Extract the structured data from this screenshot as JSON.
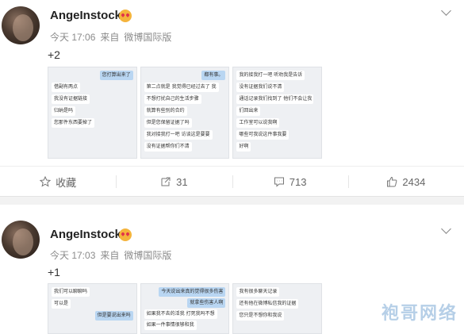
{
  "posts": [
    {
      "username": "AngeInstock",
      "time": "今天 17:06",
      "source_prefix": "来自",
      "source": "微博国际版",
      "content": "+2",
      "images": [
        {
          "bubbles": [
            {
              "t": "您打算出来了",
              "me": true
            },
            {
              "t": "借副有两点",
              "me": false
            },
            {
              "t": "我没有证据链接",
              "me": false
            },
            {
              "t": "归纳是吗",
              "me": false
            },
            {
              "t": "您那件东西要掉了",
              "me": false
            }
          ]
        },
        {
          "bubbles": [
            {
              "t": "都有事。",
              "me": true
            },
            {
              "t": "第二点就是 我觉得已经过去了 我",
              "me": false
            },
            {
              "t": "不想打扰自己的生活步骤",
              "me": false
            },
            {
              "t": "就算有些别的合约",
              "me": false
            },
            {
              "t": "但是您保留证据了吗",
              "me": false
            },
            {
              "t": "我对接我打一吧 访谈这是要要",
              "me": false
            },
            {
              "t": "没有证据帮你们不清",
              "me": false
            }
          ]
        },
        {
          "bubbles": [
            {
              "t": "我的接我打一吧 听劝我是告诉",
              "me": false
            },
            {
              "t": "没有证据我们说不清",
              "me": false
            },
            {
              "t": "通话记录我们找到了 他们不会让我",
              "me": false
            },
            {
              "t": "们回出来",
              "me": false
            },
            {
              "t": "工作室可以说我啊",
              "me": false
            },
            {
              "t": "哪些可我说这件事我要",
              "me": false
            },
            {
              "t": "好啊",
              "me": false
            }
          ]
        }
      ],
      "actions": {
        "favorite": "收藏",
        "repost": "31",
        "comment": "713",
        "like": "2434"
      }
    },
    {
      "username": "AngeInstock",
      "time": "今天 17:03",
      "source_prefix": "来自",
      "source": "微博国际版",
      "content": "+1",
      "images": [
        {
          "bubbles": [
            {
              "t": "我们可以聊聊吗",
              "me": false
            },
            {
              "t": "可以是",
              "me": false
            },
            {
              "t": "但是要说出来吗",
              "me": true
            }
          ]
        },
        {
          "bubbles": [
            {
              "t": "今天说出来真的觉得很多伤害",
              "me": true
            },
            {
              "t": "就拿些伤害人啊",
              "me": true
            },
            {
              "t": "如果我不去的活我 打死我吗不想",
              "me": false
            },
            {
              "t": "如果一件事情很够和我",
              "me": false
            }
          ]
        },
        {
          "bubbles": [
            {
              "t": "我有很多聊天记录",
              "me": false
            },
            {
              "t": "还有他在微博私信我的证据",
              "me": false
            },
            {
              "t": "您只是不想你和我说",
              "me": false
            }
          ]
        }
      ]
    }
  ],
  "watermark": "袍哥网络",
  "colors": {
    "meta": "#8b8b8b",
    "separator": "#f2f2f2",
    "emoji": "#f5b43c"
  }
}
